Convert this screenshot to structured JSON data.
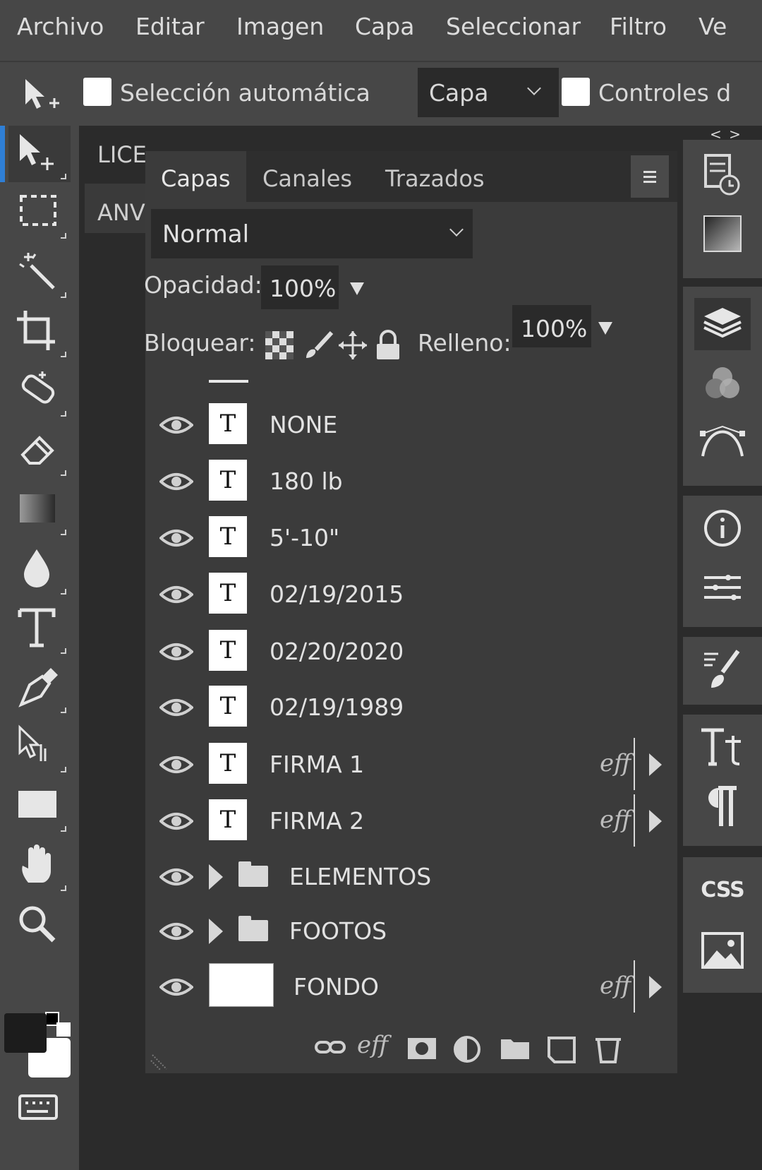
{
  "menu": [
    "Archivo",
    "Editar",
    "Imagen",
    "Capa",
    "Seleccionar",
    "Filtro",
    "Ve"
  ],
  "options": {
    "auto_select_label": "Selección automática",
    "target_value": "Capa",
    "controls_label": "Controles d"
  },
  "doc_tabs": [
    "LICE",
    "ANV"
  ],
  "panel": {
    "tabs": [
      "Capas",
      "Canales",
      "Trazados"
    ],
    "blend_mode": "Normal",
    "opacity_label": "Opacidad:",
    "opacity_value": "100%",
    "lock_label": "Bloquear:",
    "fill_label": "Relleno:",
    "fill_value": "100%"
  },
  "layers": [
    {
      "name": "NONE",
      "kind": "text",
      "thumb": "T",
      "fx": ""
    },
    {
      "name": "180 lb",
      "kind": "text",
      "thumb": "T",
      "fx": ""
    },
    {
      "name": "5'-10\"",
      "kind": "text",
      "thumb": "T",
      "fx": ""
    },
    {
      "name": "02/19/2015",
      "kind": "text",
      "thumb": "T",
      "fx": ""
    },
    {
      "name": "02/20/2020",
      "kind": "text",
      "thumb": "T",
      "fx": ""
    },
    {
      "name": "02/19/1989",
      "kind": "text",
      "thumb": "T",
      "fx": ""
    },
    {
      "name": "FIRMA 1",
      "kind": "text",
      "thumb": "T",
      "fx": "eff"
    },
    {
      "name": "FIRMA 2",
      "kind": "text",
      "thumb": "T",
      "fx": "eff"
    },
    {
      "name": "ELEMENTOS",
      "kind": "group",
      "fx": ""
    },
    {
      "name": "FOOTOS",
      "kind": "group",
      "fx": ""
    },
    {
      "name": "FONDO",
      "kind": "image",
      "fx": "eff"
    }
  ],
  "bottom_actions": {
    "fx_label": "eff"
  },
  "right_dock": {
    "css_label": "CSS",
    "toggle": "< >"
  },
  "colors": {
    "accent": "#2f7fd6",
    "bar": "#474747",
    "panel": "#3b3b3b"
  }
}
